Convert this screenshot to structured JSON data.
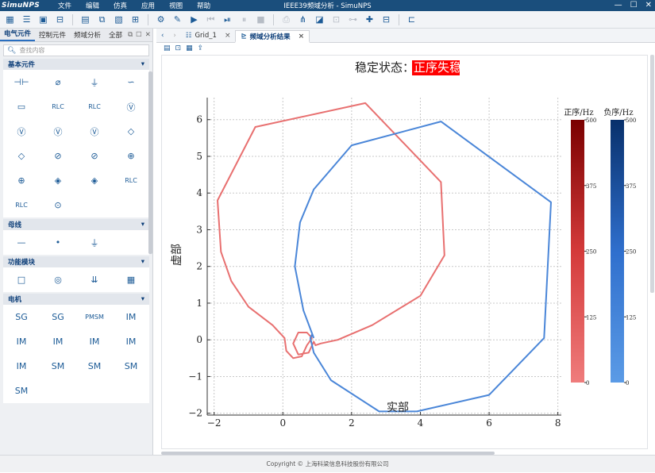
{
  "app": {
    "logo": "SimuNPS",
    "window_title": "IEEE39频域分析 - SimuNPS",
    "menus": [
      "文件",
      "编辑",
      "仿真",
      "应用",
      "视图",
      "帮助"
    ],
    "window_controls": [
      "—",
      "☐",
      "✕"
    ]
  },
  "toolbar": {
    "icons": [
      "grid-icon",
      "list-icon",
      "save-icon",
      "open-icon",
      "new-file-icon",
      "copy-file-icon",
      "package-icon",
      "export-icon",
      "settings-icon",
      "edit-icon",
      "run-icon",
      "step-back-icon",
      "play-icon",
      "pause-icon",
      "stop-icon",
      "print-icon",
      "network-icon",
      "image-icon",
      "compare-icon",
      "tree-icon",
      "add-icon",
      "panel-icon",
      "monitor-icon"
    ]
  },
  "left_panel": {
    "tabs": [
      "电气元件",
      "控制元件",
      "频域分析",
      "全部"
    ],
    "search_placeholder": "查找内容",
    "groups": [
      {
        "title": "基本元件",
        "items": [
          "⊣⊢",
          "⌀",
          "⏚",
          "∽",
          "▭",
          "RLC",
          "RLC",
          "Ⓥ",
          "Ⓥ",
          "Ⓥ",
          "Ⓥ",
          "◇",
          "◇",
          "⊘",
          "⊘",
          "⊕",
          "⊕",
          "◈",
          "◈",
          "RLC",
          "RLC",
          "⊙"
        ]
      },
      {
        "title": "母线",
        "items": [
          "—",
          "•",
          "⏚"
        ]
      },
      {
        "title": "功能模块",
        "items": [
          "□",
          "◎",
          "⇊",
          "▦"
        ]
      },
      {
        "title": "电机",
        "items": [
          "SG",
          "SG",
          "PMSM",
          "IM",
          "IM",
          "IM",
          "IM",
          "IM",
          "IM",
          "SM",
          "SM",
          "SM",
          "SM"
        ]
      }
    ]
  },
  "main": {
    "tabs": [
      {
        "label": "Grid_1",
        "close": "×",
        "active": false
      },
      {
        "label": "频域分析结果",
        "close": "×",
        "active": true
      }
    ],
    "status_label": "稳定状态：",
    "status_value": "正序失稳",
    "status_color": "#ff0000"
  },
  "footer": {
    "text": "Copyright © 上海科梁信息科技股份有限公司"
  },
  "chart_data": {
    "type": "line",
    "xlabel": "实部",
    "ylabel": "虚部",
    "xlim": [
      -2.2,
      8.1
    ],
    "ylim": [
      -2.05,
      6.6
    ],
    "xticks": [
      -2,
      0,
      2,
      4,
      6,
      8
    ],
    "yticks": [
      -2,
      -1,
      0,
      1,
      2,
      3,
      4,
      5,
      6
    ],
    "grid": true,
    "series": [
      {
        "name": "正序/Hz",
        "color": "#e87070",
        "points": [
          [
            0.85,
            0.05
          ],
          [
            0.7,
            -0.15
          ],
          [
            0.55,
            -0.45
          ],
          [
            0.3,
            -0.5
          ],
          [
            0.1,
            -0.3
          ],
          [
            0.05,
            0.05
          ],
          [
            -0.3,
            0.4
          ],
          [
            -1.0,
            0.9
          ],
          [
            -1.5,
            1.6
          ],
          [
            -1.8,
            2.4
          ],
          [
            -1.9,
            3.8
          ],
          [
            -0.8,
            5.8
          ],
          [
            2.4,
            6.45
          ],
          [
            4.6,
            4.3
          ],
          [
            4.7,
            2.3
          ],
          [
            4.0,
            1.2
          ],
          [
            2.6,
            0.4
          ],
          [
            1.6,
            0.0
          ],
          [
            1.1,
            -0.1
          ],
          [
            0.95,
            -0.15
          ],
          [
            0.9,
            -0.05
          ],
          [
            0.75,
            -0.35
          ],
          [
            0.45,
            -0.4
          ],
          [
            0.3,
            -0.1
          ],
          [
            0.45,
            0.2
          ],
          [
            0.7,
            0.2
          ],
          [
            0.85,
            0.05
          ]
        ]
      },
      {
        "name": "负序/Hz",
        "color": "#4a86d8",
        "points": [
          [
            0.9,
            0.05
          ],
          [
            0.6,
            0.8
          ],
          [
            0.35,
            2.0
          ],
          [
            0.5,
            3.2
          ],
          [
            0.9,
            4.1
          ],
          [
            2.0,
            5.3
          ],
          [
            4.6,
            5.95
          ],
          [
            7.8,
            3.75
          ],
          [
            7.6,
            0.05
          ],
          [
            6.0,
            -1.5
          ],
          [
            3.9,
            -1.95
          ],
          [
            2.8,
            -1.95
          ],
          [
            1.4,
            -1.1
          ],
          [
            0.9,
            -0.35
          ],
          [
            0.8,
            0.05
          ],
          [
            0.85,
            0.15
          ],
          [
            0.9,
            0.05
          ]
        ]
      }
    ],
    "colorbars": [
      {
        "label": "正序/Hz",
        "ticks": [
          500,
          375,
          250,
          125,
          0
        ],
        "top_color": "#7a0000",
        "bottom_color": "#ef7c7c"
      },
      {
        "label": "负序/Hz",
        "ticks": [
          500,
          375,
          250,
          125,
          0
        ],
        "top_color": "#08306b",
        "bottom_color": "#5b9be6"
      }
    ]
  }
}
